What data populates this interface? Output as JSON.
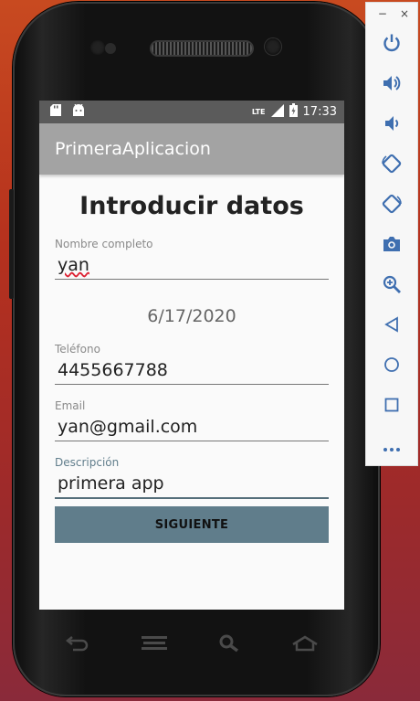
{
  "status_bar": {
    "time": "17:33",
    "network": "LTE",
    "icons": [
      "sd-card-icon",
      "android-icon",
      "signal-icon",
      "battery-icon"
    ]
  },
  "app_bar": {
    "title": "PrimeraAplicacion"
  },
  "form": {
    "heading": "Introducir datos",
    "name_label": "Nombre completo",
    "name_value": "yan",
    "date": "6/17/2020",
    "phone_label": "Teléfono",
    "phone_value": "4455667788",
    "email_label": "Email",
    "email_value": "yan@gmail.com",
    "desc_label": "Descripción",
    "desc_value": "primera app",
    "next_button": "SIGUIENTE"
  },
  "phone_nav": {
    "icons": [
      "back-icon",
      "menu-icon",
      "search-icon",
      "home-icon"
    ]
  },
  "emulator_toolbar": {
    "window_controls": {
      "minimize": "−",
      "close": "×"
    },
    "tools": [
      "power-icon",
      "volume-up-icon",
      "volume-down-icon",
      "rotate-left-icon",
      "rotate-right-icon",
      "camera-icon",
      "zoom-icon",
      "back-icon",
      "home-icon",
      "overview-icon",
      "more-icon"
    ]
  },
  "colors": {
    "accent": "#607d8b",
    "app_bar": "#a3a3a3",
    "status_bar": "#5b5b5b",
    "toolbar_icon": "#3f6fb0"
  }
}
